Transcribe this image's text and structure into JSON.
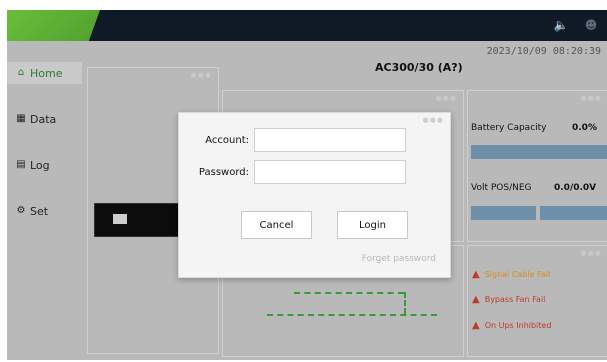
{
  "topbar": {
    "icons": [
      "speaker-icon",
      "user-icon"
    ],
    "brand_color": "#5db437",
    "bg_color": "#0f1a26"
  },
  "status": {
    "datetime": "2023/10/09 08:20:39"
  },
  "sidebar": {
    "items": [
      {
        "label": "Home",
        "icon": "home-icon",
        "active": true
      },
      {
        "label": "Data",
        "icon": "data-icon",
        "active": false
      },
      {
        "label": "Log",
        "icon": "log-icon",
        "active": false
      },
      {
        "label": "Set",
        "icon": "settings-icon",
        "active": false
      }
    ]
  },
  "device": {
    "title": "AC300/30 (A?)"
  },
  "metrics": {
    "battery_capacity": {
      "label": "Battery Capacity",
      "value": "0.0%"
    },
    "volt": {
      "label": "Volt POS/NEG",
      "value": "0.0/0.0V"
    }
  },
  "alarms": [
    {
      "text": "Signal Cable Fail",
      "color": "#d98b1a"
    },
    {
      "text": "Bypass Fan Fail",
      "color": "#c0392b"
    },
    {
      "text": "On Ups Inhibited",
      "color": "#c0392b"
    }
  ],
  "login": {
    "account_label": "Account:",
    "password_label": "Password:",
    "account_value": "",
    "password_value": "",
    "cancel_label": "Cancel",
    "login_label": "Login",
    "forgot_label": "Forget password"
  }
}
